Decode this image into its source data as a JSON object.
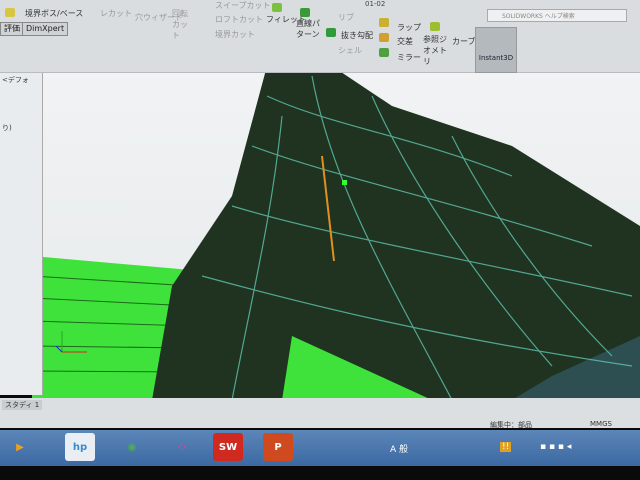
{
  "window": {
    "title": "01-02"
  },
  "ribbon": {
    "boss_base": "境界ボス/ベース",
    "cut": "レカット",
    "wizard": "穴ウィザード",
    "revolve_cut": "回転カット",
    "sweep_cut": "スイープカット",
    "loft_cut": "ロフトカット",
    "boundary_cut": "境界カット",
    "fillet": "フィレット",
    "linear_pattern": "直線パターン",
    "rib": "リブ",
    "draft": "抜き勾配",
    "shell": "シェル",
    "wrap": "ラップ",
    "intersect": "交差",
    "mirror": "ミラー",
    "ref_geometry": "参照ジオメトリ",
    "curves": "カーブ",
    "instant3d": "Instant3D"
  },
  "search": {
    "placeholder": "SOLIDWORKS ヘルプ検索"
  },
  "tabs": [
    "評価",
    "DimXpert"
  ],
  "panel": {
    "item1": "<デフォ",
    "item2": "り)"
  },
  "bottom_tab": "スタディ 1",
  "status": {
    "editing": "編集中：部品",
    "units": "MMGS"
  },
  "taskbar": {
    "apps": [
      "Media",
      "HP",
      "Chrome",
      "App",
      "SW",
      "P"
    ],
    "ime": "A 般"
  }
}
